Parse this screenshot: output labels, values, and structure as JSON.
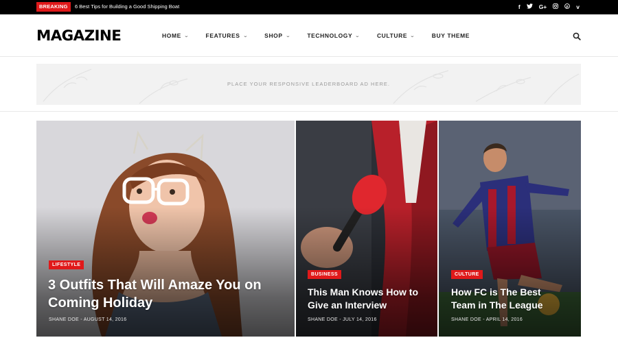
{
  "topbar": {
    "breaking_label": "BREAKING",
    "ticker_text": "6 Best Tips for Building a Good Shipping Boat",
    "socials": [
      {
        "icon": "facebook-icon",
        "glyph": "f"
      },
      {
        "icon": "twitter-icon",
        "glyph": "🐦"
      },
      {
        "icon": "google-plus-icon",
        "glyph": "G+"
      },
      {
        "icon": "instagram-icon",
        "glyph": "◎"
      },
      {
        "icon": "pinterest-icon",
        "glyph": "℗"
      },
      {
        "icon": "vimeo-icon",
        "glyph": "v"
      }
    ]
  },
  "header": {
    "logo": "MAGAZINE",
    "nav": [
      {
        "label": "HOME",
        "has_dropdown": true
      },
      {
        "label": "FEATURES",
        "has_dropdown": true
      },
      {
        "label": "SHOP",
        "has_dropdown": true
      },
      {
        "label": "TECHNOLOGY",
        "has_dropdown": true
      },
      {
        "label": "CULTURE",
        "has_dropdown": true
      },
      {
        "label": "BUY THEME",
        "has_dropdown": false
      }
    ],
    "search_icon": "search-icon"
  },
  "ad": {
    "text": "PLACE YOUR RESPONSIVE LEADERBOARD AD HERE."
  },
  "posts": [
    {
      "category": "LIFESTYLE",
      "title_line1": "3 Outfits That Will Amaze You on",
      "title_line2": "Coming Holiday",
      "author": "SHANE DOE",
      "date": "AUGUST 14, 2016"
    },
    {
      "category": "BUSINESS",
      "title_line1": "This Man Knows How to",
      "title_line2": "Give an Interview",
      "author": "SHANE DOE",
      "date": "JULY 14, 2016"
    },
    {
      "category": "CULTURE",
      "title_line1": "How FC is The Best",
      "title_line2": "Team in The League",
      "author": "SHANE DOE",
      "date": "APRIL 14, 2016"
    }
  ],
  "colors": {
    "accent": "#e0191a",
    "topbar_bg": "#000000",
    "ad_bg": "#f2f2f2"
  }
}
